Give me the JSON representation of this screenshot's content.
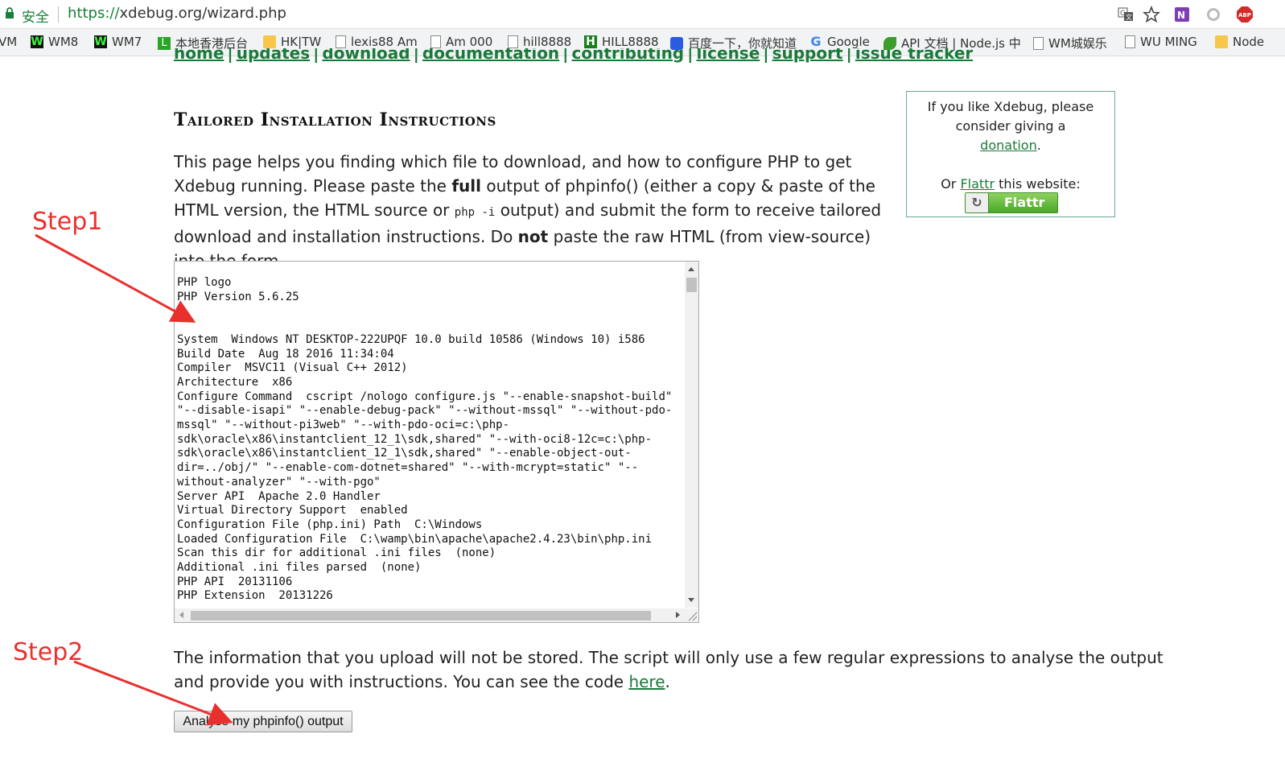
{
  "browser": {
    "secure_label": "安全",
    "url_scheme": "https://",
    "url_rest": "xdebug.org/wizard.php",
    "bookmarks": [
      {
        "label": "VM",
        "icon": "none"
      },
      {
        "label": "WM8",
        "icon": "w-icon"
      },
      {
        "label": "WM7",
        "icon": "w-icon"
      },
      {
        "label": "本地香港后台",
        "icon": "l-icon"
      },
      {
        "label": "HK|TW",
        "icon": "folder-icon"
      },
      {
        "label": "lexis88 Am",
        "icon": "doc-icon"
      },
      {
        "label": "Am 000",
        "icon": "doc-icon"
      },
      {
        "label": "hill8888",
        "icon": "doc-icon"
      },
      {
        "label": "HILL8888",
        "icon": "h-icon"
      },
      {
        "label": "百度一下，你就知道",
        "icon": "baidu-icon"
      },
      {
        "label": "Google",
        "icon": "google-icon"
      },
      {
        "label": "API 文档 | Node.js 中",
        "icon": "node-icon"
      },
      {
        "label": "WM城娱乐",
        "icon": "doc-icon"
      },
      {
        "label": "WU MING",
        "icon": "doc-icon"
      },
      {
        "label": "Node",
        "icon": "folder-icon"
      }
    ]
  },
  "page": {
    "nav": [
      "home",
      "updates",
      "download",
      "documentation",
      "contributing",
      "license",
      "support",
      "issue tracker"
    ],
    "nav_separator": "|",
    "heading": "Tailored Installation Instructions",
    "intro": {
      "part1": "This page helps you finding which file to download, and how to configure PHP to get Xdebug running. Please paste the ",
      "bold1": "full",
      "part2": " output of phpinfo() (either a copy & paste of the HTML version, the HTML source or ",
      "code": "php -i",
      "part3": " output) and submit the form to receive tailored download and installation instructions. Do ",
      "bold2": "not",
      "part4": " paste the raw HTML (from view-source) into the form."
    },
    "donate": {
      "line1": "If you like Xdebug, please consider giving a",
      "donation_link": "donation",
      "period": ".",
      "or": "Or ",
      "flattr_link": "Flattr",
      "this_website": " this website:",
      "flattr_button": "Flattr"
    },
    "textarea_content": "PHP logo\nPHP Version 5.6.25\n\n\nSystem  Windows NT DESKTOP-222UPQF 10.0 build 10586 (Windows 10) i586\nBuild Date  Aug 18 2016 11:34:04\nCompiler  MSVC11 (Visual C++ 2012)\nArchitecture  x86\nConfigure Command  cscript /nologo configure.js \"--enable-snapshot-build\" \"--disable-isapi\" \"--enable-debug-pack\" \"--without-mssql\" \"--without-pdo-mssql\" \"--without-pi3web\" \"--with-pdo-oci=c:\\php-sdk\\oracle\\x86\\instantclient_12_1\\sdk,shared\" \"--with-oci8-12c=c:\\php-sdk\\oracle\\x86\\instantclient_12_1\\sdk,shared\" \"--enable-object-out-dir=../obj/\" \"--enable-com-dotnet=shared\" \"--with-mcrypt=static\" \"--without-analyzer\" \"--with-pgo\"\nServer API  Apache 2.0 Handler\nVirtual Directory Support  enabled\nConfiguration File (php.ini) Path  C:\\Windows\nLoaded Configuration File  C:\\wamp\\bin\\apache\\apache2.4.23\\bin\\php.ini\nScan this dir for additional .ini files  (none)\nAdditional .ini files parsed  (none)\nPHP API  20131106\nPHP Extension  20131226",
    "info_text": "The information that you upload will not be stored. The script will only use a few regular expressions to analyse the output and provide you with instructions. You can see the code ",
    "info_link": "here",
    "info_end": ".",
    "submit_label": "Analyse my phpinfo() output"
  },
  "annotations": {
    "step1": "Step1",
    "step2": "Step2",
    "color": "#e8312f"
  }
}
